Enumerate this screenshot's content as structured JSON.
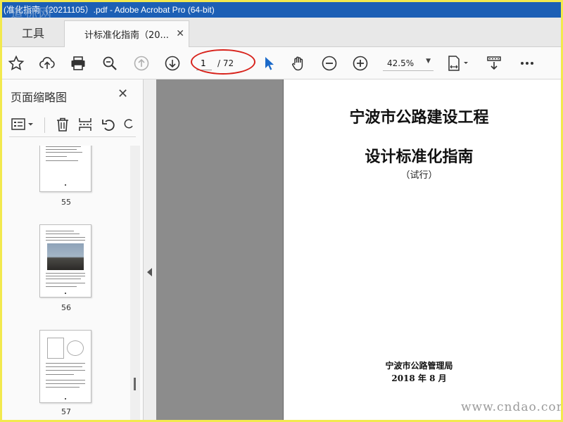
{
  "window": {
    "title": "(准化指南（20211105）.pdf - Adobe Acrobat Pro (64-bit)"
  },
  "watermark": {
    "top": "道标网",
    "bottom": "www.cndao.com"
  },
  "tabs": {
    "tools_label": "工具",
    "doc_label": "计标准化指南（20...",
    "close_glyph": "✕"
  },
  "toolbar": {
    "page_current": "1",
    "page_total": "/ 72",
    "zoom": "42.5%"
  },
  "sidebar": {
    "title": "页面缩略图",
    "close_glyph": "✕",
    "thumbnails": [
      {
        "label": "55"
      },
      {
        "label": "56"
      },
      {
        "label": "57"
      }
    ]
  },
  "document": {
    "title_line1": "宁波市公路建设工程",
    "title_line2": "设计标准化指南",
    "subtitle": "（试行）",
    "organization": "宁波市公路管理局",
    "date": "2018 年 8 月"
  },
  "colors": {
    "titlebar": "#1c5fb5",
    "annotation_ellipse": "#d8231c",
    "cursor_tool_active": "#1b6ac9",
    "outer_border": "#f2e94e"
  }
}
